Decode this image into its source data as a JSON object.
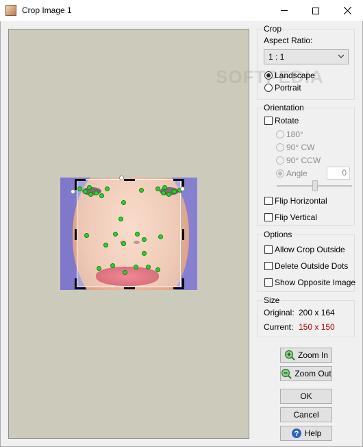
{
  "window": {
    "title": "Crop Image 1",
    "controls": {
      "minimize": "—",
      "maximize": "☐",
      "close": "✕"
    }
  },
  "watermark": "SOFTPEDIA",
  "crop": {
    "title": "Crop",
    "aspect_label": "Aspect Ratio:",
    "aspect_value": "1 : 1",
    "landscape": "Landscape",
    "portrait": "Portrait",
    "selected": "landscape"
  },
  "orientation": {
    "title": "Orientation",
    "rotate": "Rotate",
    "opt_180": "180°",
    "opt_90cw": "90° CW",
    "opt_90ccw": "90° CCW",
    "angle_label": "Angle",
    "angle_value": "0",
    "flip_h": "Flip Horizontal",
    "flip_v": "Flip Vertical"
  },
  "options": {
    "title": "Options",
    "allow_crop_outside": "Allow Crop Outside",
    "delete_outside_dots": "Delete Outside Dots",
    "show_opposite_image": "Show Opposite Image"
  },
  "size": {
    "title": "Size",
    "original_label": "Original:",
    "original_value": "200 x 164",
    "current_label": "Current:",
    "current_value": "150 x 150",
    "current_color": "#b00000"
  },
  "buttons": {
    "zoom_in": "Zoom In",
    "zoom_out": "Zoom Out",
    "ok": "OK",
    "cancel": "Cancel",
    "help": "Help"
  }
}
